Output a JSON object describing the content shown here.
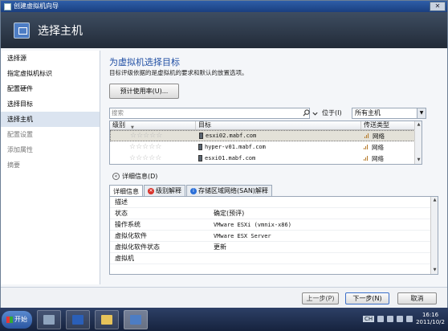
{
  "window": {
    "title": "创建虚拟机向导",
    "header_title": "选择主机"
  },
  "nav": {
    "items": [
      {
        "label": "选择源",
        "state": "normal"
      },
      {
        "label": "指定虚拟机标识",
        "state": "normal"
      },
      {
        "label": "配置硬件",
        "state": "normal"
      },
      {
        "label": "选择目标",
        "state": "normal"
      },
      {
        "label": "选择主机",
        "state": "active"
      },
      {
        "label": "配置设置",
        "state": "disabled"
      },
      {
        "label": "添加属性",
        "state": "disabled"
      },
      {
        "label": "摘要",
        "state": "disabled"
      }
    ]
  },
  "main": {
    "title": "为虚拟机选择目标",
    "description": "目标评级依据的是虚拟机的要求和默认的放置选项。",
    "recommend_button": "预计使用率(U)...",
    "search_placeholder": "搜索",
    "position_label": "位于(I)",
    "position_value": "所有主机",
    "columns": {
      "rating": "级别",
      "target": "目标",
      "transfer_type": "传送类型"
    },
    "hosts": [
      {
        "rating_stars": "☆☆☆☆☆",
        "target": "esxi02.mabf.com",
        "transfer_type": "网络",
        "selected": true
      },
      {
        "rating_stars": "☆☆☆☆☆",
        "target": "hyper-v01.mabf.com",
        "transfer_type": "网络",
        "selected": false
      },
      {
        "rating_stars": "☆☆☆☆☆",
        "target": "esxi01.mabf.com",
        "transfer_type": "网络",
        "selected": false
      }
    ],
    "details_toggle": "详细信息(D)",
    "tabs": [
      {
        "label": "详细信息",
        "icon": "none",
        "active": true
      },
      {
        "label": "级别解释",
        "icon": "error-icon",
        "active": false
      },
      {
        "label": "存储区域网络(SAN)解释",
        "icon": "info-icon",
        "active": false
      }
    ],
    "properties": [
      {
        "name": "描述",
        "value": ""
      },
      {
        "name": "状态",
        "value": "确定(预评)"
      },
      {
        "name": "操作系统",
        "value": "VMware ESXi (vmnix-x86)"
      },
      {
        "name": "虚拟化软件",
        "value": "VMware ESX Server"
      },
      {
        "name": "虚拟化软件状态",
        "value": "更新"
      },
      {
        "name": "虚拟机",
        "value": ""
      }
    ]
  },
  "footer": {
    "prev": "上一步(P)",
    "next": "下一步(N)",
    "cancel": "取消"
  },
  "taskbar": {
    "start": "开始",
    "ime": "CH",
    "time": "16:16",
    "date": "2011/10/2"
  },
  "colors": {
    "accent_title": "#1f4ea3",
    "header_bg": "#2b3544",
    "transfer_icon": "#b67a2a",
    "error": "#d8322b"
  }
}
